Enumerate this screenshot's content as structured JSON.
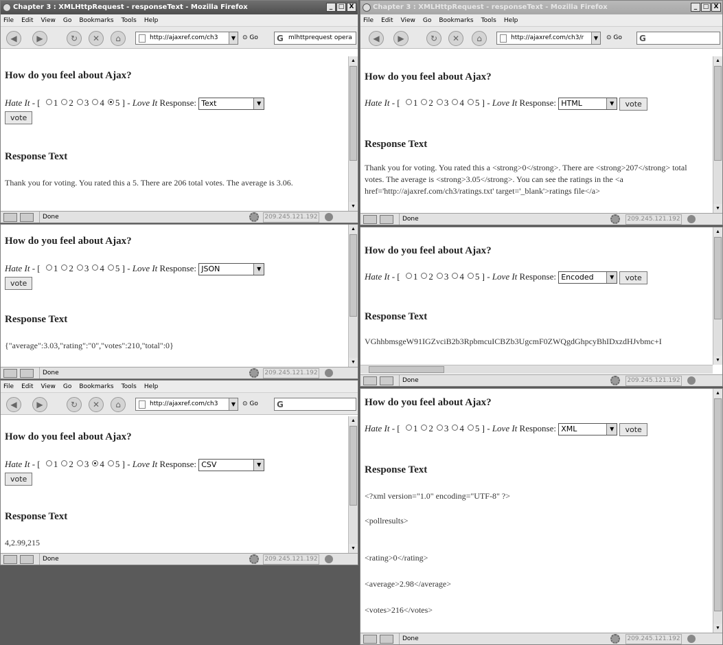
{
  "browser": {
    "title": "Chapter 3 : XMLHttpRequest - responseText - Mozilla Firefox",
    "menu": [
      "File",
      "Edit",
      "View",
      "Go",
      "Bookmarks",
      "Tools",
      "Help"
    ],
    "go_label": "Go",
    "status": "Done",
    "ip": "209.245.121.192",
    "win_minimize": "_",
    "win_maximize": "□",
    "win_close": "X"
  },
  "poll": {
    "question": "How do you feel about Ajax?",
    "hate": "Hate It",
    "open": " - [ ",
    "close": " ] - ",
    "love": "Love It",
    "response_label": " Response: ",
    "vote": "vote",
    "response_heading": "Response Text",
    "ratings": [
      "1",
      "2",
      "3",
      "4",
      "5"
    ]
  },
  "panes": {
    "text": {
      "url": "http://ajaxref.com/ch3",
      "search": "mlhttprequest opera",
      "format": "Text",
      "selected_rating": "5",
      "response": "Thank you for voting. You rated this a 5. There are 206 total votes. The average is 3.06."
    },
    "html": {
      "url": "http://ajaxref.com/ch3/r",
      "format": "HTML",
      "selected_rating": "",
      "response": "Thank you for voting. You rated this a <strong>0</strong>. There are <strong>207</strong> total votes. The average is <strong>3.05</strong>. You can see the ratings in the <a href='http://ajaxref.com/ch3/ratings.txt' target='_blank'>ratings file</a>"
    },
    "json": {
      "format": "JSON",
      "selected_rating": "",
      "response": "{\"average\":3.03,\"rating\":\"0\",\"votes\":210,\"total\":0}"
    },
    "encoded": {
      "format": "Encoded",
      "selected_rating": "",
      "response": "VGhhbmsgeW91IGZvciB2b3RpbmcuICBZb3UgcmF0ZWQgdGhpcyBhIDxzdHJvbmc+I"
    },
    "csv": {
      "url": "http://ajaxref.com/ch3",
      "format": "CSV",
      "selected_rating": "4",
      "response": "4,2.99,215"
    },
    "xml": {
      "format": "XML",
      "selected_rating": "",
      "lines": [
        "<?xml version=\"1.0\" encoding=\"UTF-8\" ?>",
        "<pollresults>",
        "<rating>0</rating>",
        "<average>2.98</average>",
        "<votes>216</votes>"
      ]
    }
  }
}
